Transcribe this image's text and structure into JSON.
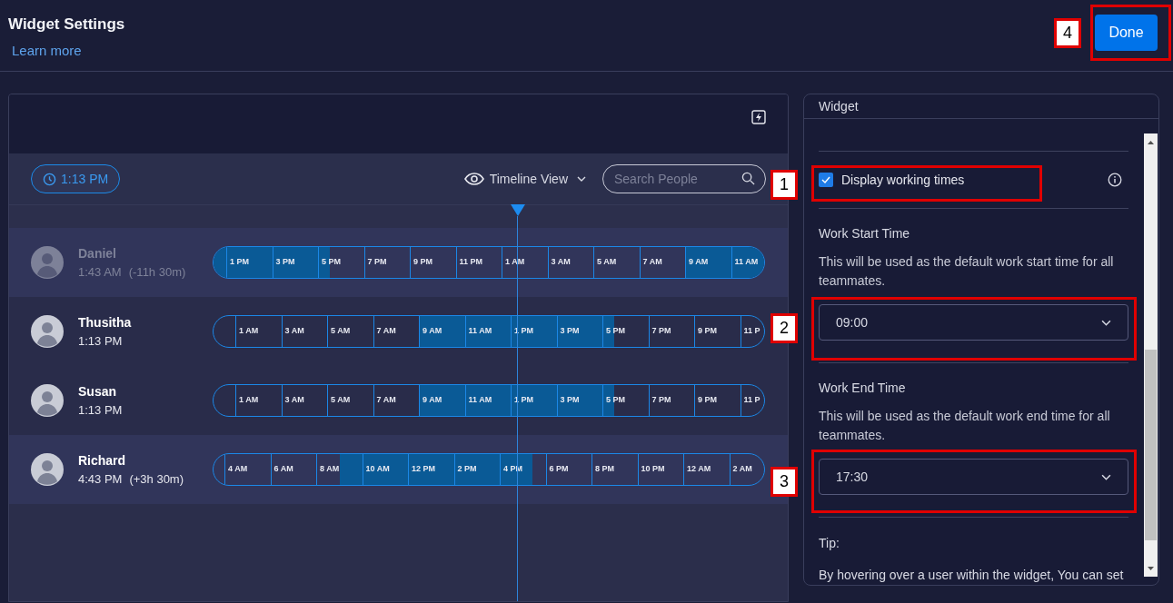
{
  "header": {
    "title": "Widget Settings",
    "link": "Learn more",
    "done_button": "Done"
  },
  "toolbar": {
    "current_time": "1:13 PM",
    "view": "Timeline View",
    "search": {
      "placeholder": "Search People"
    }
  },
  "people": [
    {
      "name": "Daniel",
      "time": "1:43 AM",
      "offset": "(-11h 30m)",
      "dimmed": true,
      "shaded": true,
      "slots": [
        {
          "kind": "work"
        },
        {
          "label": "1 PM",
          "kind": "work"
        },
        {
          "label": "3 PM",
          "kind": "work"
        },
        {
          "label": "5 PM",
          "kind": "evening"
        },
        {
          "label": "7 PM",
          "kind": "off"
        },
        {
          "label": "9 PM",
          "kind": "off"
        },
        {
          "label": "11 PM",
          "kind": "off"
        },
        {
          "label": "1 AM",
          "kind": "off"
        },
        {
          "label": "3 AM",
          "kind": "off"
        },
        {
          "label": "5 AM",
          "kind": "off"
        },
        {
          "label": "7 AM",
          "kind": "off"
        },
        {
          "label": "9 AM",
          "kind": "work"
        },
        {
          "label": "11 AM",
          "kind": "work"
        }
      ]
    },
    {
      "name": "Thusitha",
      "time": "1:13 PM",
      "dimmed": false,
      "shaded": false,
      "slots": [
        {
          "kind": "off"
        },
        {
          "label": "1 AM",
          "kind": "off"
        },
        {
          "label": "3 AM",
          "kind": "off"
        },
        {
          "label": "5 AM",
          "kind": "off"
        },
        {
          "label": "7 AM",
          "kind": "off"
        },
        {
          "label": "9 AM",
          "kind": "work"
        },
        {
          "label": "11 AM",
          "kind": "work"
        },
        {
          "label": "1 PM",
          "kind": "work"
        },
        {
          "label": "3 PM",
          "kind": "work"
        },
        {
          "label": "5 PM",
          "kind": "evening"
        },
        {
          "label": "7 PM",
          "kind": "off"
        },
        {
          "label": "9 PM",
          "kind": "off"
        },
        {
          "label": "11 P",
          "kind": "off"
        }
      ]
    },
    {
      "name": "Susan",
      "time": "1:13 PM",
      "dimmed": false,
      "shaded": false,
      "slots": [
        {
          "kind": "off"
        },
        {
          "label": "1 AM",
          "kind": "off"
        },
        {
          "label": "3 AM",
          "kind": "off"
        },
        {
          "label": "5 AM",
          "kind": "off"
        },
        {
          "label": "7 AM",
          "kind": "off"
        },
        {
          "label": "9 AM",
          "kind": "work"
        },
        {
          "label": "11 AM",
          "kind": "work"
        },
        {
          "label": "1 PM",
          "kind": "work"
        },
        {
          "label": "3 PM",
          "kind": "work"
        },
        {
          "label": "5 PM",
          "kind": "evening"
        },
        {
          "label": "7 PM",
          "kind": "off"
        },
        {
          "label": "9 PM",
          "kind": "off"
        },
        {
          "label": "11 P",
          "kind": "off"
        }
      ]
    },
    {
      "name": "Richard",
      "time": "4:43 PM",
      "offset": "(+3h 30m)",
      "dimmed": false,
      "shaded": true,
      "slots": [
        {
          "kind": "off"
        },
        {
          "label": "4 AM",
          "kind": "off"
        },
        {
          "label": "6 AM",
          "kind": "off"
        },
        {
          "label": "8 AM",
          "kind": "morning"
        },
        {
          "label": "10 AM",
          "kind": "work"
        },
        {
          "label": "12 PM",
          "kind": "work"
        },
        {
          "label": "2 PM",
          "kind": "work"
        },
        {
          "label": "4 PM",
          "kind": "overtime"
        },
        {
          "label": "6 PM",
          "kind": "off"
        },
        {
          "label": "8 PM",
          "kind": "off"
        },
        {
          "label": "10 PM",
          "kind": "off"
        },
        {
          "label": "12 AM",
          "kind": "off"
        },
        {
          "label": "2 AM",
          "kind": "off"
        }
      ]
    }
  ],
  "settings": {
    "title": "Widget",
    "display_working_times": {
      "label": "Display working times",
      "checked": true
    },
    "start": {
      "title": "Work Start Time",
      "description": "This will be used as the default work start time for all teammates.",
      "value": "09:00"
    },
    "end": {
      "title": "Work End Time",
      "description": "This will be used as the default work end time for all teammates.",
      "value": "17:30"
    },
    "tip": {
      "title": "Tip:",
      "text": "By hovering over a user within the widget, You can set"
    }
  },
  "annotations": [
    {
      "label": "1"
    },
    {
      "label": "2"
    },
    {
      "label": "3"
    },
    {
      "label": "4"
    }
  ]
}
